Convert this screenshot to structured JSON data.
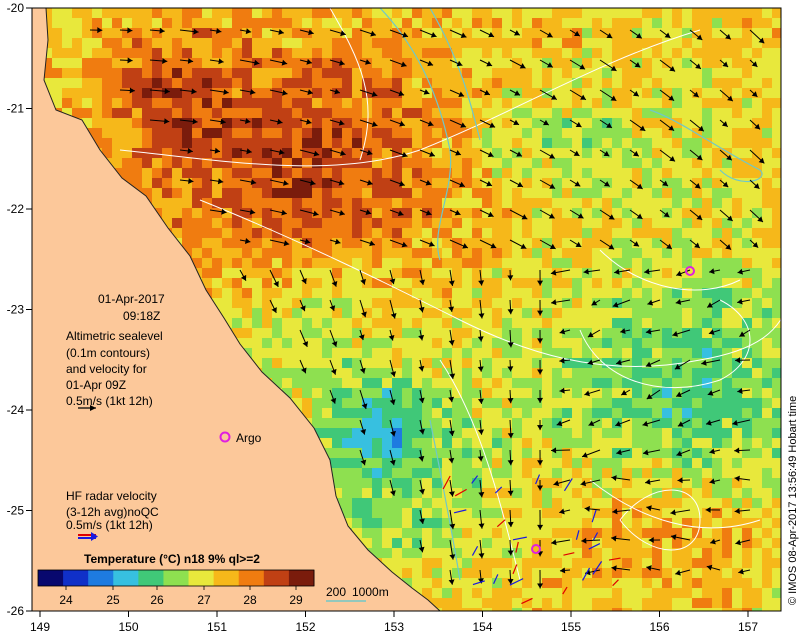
{
  "axes": {
    "lon_ticks": [
      "149",
      "150",
      "151",
      "152",
      "153",
      "154",
      "155",
      "156",
      "157"
    ],
    "lat_ticks": [
      "-20",
      "-21",
      "-22",
      "-23",
      "-24",
      "-25",
      "-26"
    ]
  },
  "info": {
    "date": "01-Apr-2017",
    "time": "09:18Z",
    "altimetry_lines": [
      "Altimetric sealevel",
      "(0.1m contours)",
      "and velocity for",
      "01-Apr 09Z"
    ],
    "altimetry_scale": "0.5m/s (1kt 12h)",
    "argo_label": "Argo",
    "hf_lines": [
      "HF radar velocity",
      "(3-12h avg)noQC"
    ],
    "hf_scale": "0.5m/s (1kt 12h)"
  },
  "colorbar": {
    "title": "Temperature (°C) n18 9% ql>=2",
    "ticks": [
      "24",
      "25",
      "26",
      "27",
      "28",
      "29"
    ],
    "colors": [
      "#08086e",
      "#1030c8",
      "#1e7be0",
      "#37c0e0",
      "#40c878",
      "#8ee050",
      "#e8e83c",
      "#f6b81a",
      "#f07c10",
      "#c04014",
      "#7a1c0c"
    ]
  },
  "depth_legend": {
    "label_200": "200",
    "label_1000": "1000m"
  },
  "credit": "© IMOS 08-Apr-2017 13:56:49 Hobart time",
  "colors": {
    "land": "#fcc89a",
    "altimetry_arrow": "#000000",
    "hf_arrow_red": "#e00000",
    "hf_arrow_blue": "#1a1ae0",
    "argo_marker": "#e020e0",
    "isobath": "#70c8c8"
  }
}
